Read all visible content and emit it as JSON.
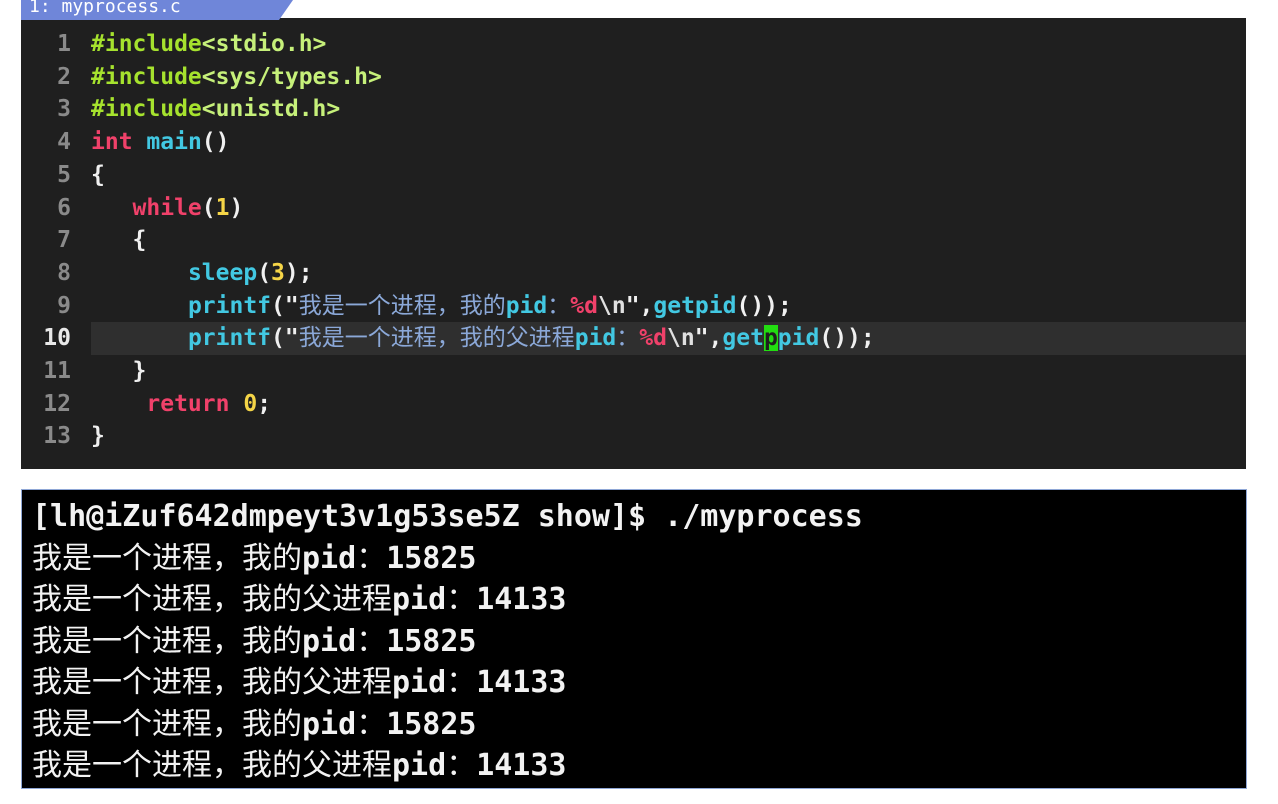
{
  "editor": {
    "tab_title": "1: myprocess.c",
    "current_line": 10,
    "lines": [
      {
        "num": "1",
        "segments": [
          {
            "t": "#include",
            "c": "pre"
          },
          {
            "t": "<stdio.h>",
            "c": "hdr"
          }
        ]
      },
      {
        "num": "2",
        "segments": [
          {
            "t": "#include",
            "c": "pre"
          },
          {
            "t": "<sys/types.h>",
            "c": "hdr"
          }
        ]
      },
      {
        "num": "3",
        "segments": [
          {
            "t": "#include",
            "c": "pre"
          },
          {
            "t": "<unistd.h>",
            "c": "hdr"
          }
        ]
      },
      {
        "num": "4",
        "segments": [
          {
            "t": "int",
            "c": "kw"
          },
          {
            "t": " ",
            "c": "plain"
          },
          {
            "t": "main",
            "c": "fn"
          },
          {
            "t": "()",
            "c": "plain"
          }
        ]
      },
      {
        "num": "5",
        "segments": [
          {
            "t": "{",
            "c": "plain"
          }
        ]
      },
      {
        "num": "6",
        "segments": [
          {
            "t": "   ",
            "c": "plain"
          },
          {
            "t": "while",
            "c": "kw"
          },
          {
            "t": "(",
            "c": "plain"
          },
          {
            "t": "1",
            "c": "num"
          },
          {
            "t": ")",
            "c": "plain"
          }
        ]
      },
      {
        "num": "7",
        "segments": [
          {
            "t": "   {",
            "c": "plain"
          }
        ]
      },
      {
        "num": "8",
        "segments": [
          {
            "t": "       ",
            "c": "plain"
          },
          {
            "t": "sleep",
            "c": "fn"
          },
          {
            "t": "(",
            "c": "plain"
          },
          {
            "t": "3",
            "c": "num"
          },
          {
            "t": ");",
            "c": "plain"
          }
        ]
      },
      {
        "num": "9",
        "segments": [
          {
            "t": "       ",
            "c": "plain"
          },
          {
            "t": "printf",
            "c": "fn"
          },
          {
            "t": "(\"",
            "c": "plain"
          },
          {
            "t": "我是一个进程，我的",
            "c": "cjk"
          },
          {
            "t": "pid",
            "c": "fn"
          },
          {
            "t": "：",
            "c": "cjk"
          },
          {
            "t": "%d",
            "c": "fmt"
          },
          {
            "t": "\\n",
            "c": "esc"
          },
          {
            "t": "\",",
            "c": "plain"
          },
          {
            "t": "getpid",
            "c": "fn"
          },
          {
            "t": "());",
            "c": "plain"
          }
        ]
      },
      {
        "num": "10",
        "segments": [
          {
            "t": "       ",
            "c": "plain"
          },
          {
            "t": "printf",
            "c": "fn"
          },
          {
            "t": "(\"",
            "c": "plain"
          },
          {
            "t": "我是一个进程，我的父进程",
            "c": "cjk"
          },
          {
            "t": "pid",
            "c": "fn"
          },
          {
            "t": "：",
            "c": "cjk"
          },
          {
            "t": "%d",
            "c": "fmt"
          },
          {
            "t": "\\n",
            "c": "esc"
          },
          {
            "t": "\",",
            "c": "plain"
          },
          {
            "t": "get",
            "c": "fn"
          },
          {
            "t": "p",
            "c": "cur"
          },
          {
            "t": "pid",
            "c": "fn"
          },
          {
            "t": "());",
            "c": "plain"
          }
        ]
      },
      {
        "num": "11",
        "segments": [
          {
            "t": "   }",
            "c": "plain"
          }
        ]
      },
      {
        "num": "12",
        "segments": [
          {
            "t": "    ",
            "c": "plain"
          },
          {
            "t": "return",
            "c": "kw"
          },
          {
            "t": " ",
            "c": "plain"
          },
          {
            "t": "0",
            "c": "num"
          },
          {
            "t": ";",
            "c": "plain"
          }
        ]
      },
      {
        "num": "13",
        "segments": [
          {
            "t": "}",
            "c": "plain"
          }
        ]
      }
    ]
  },
  "terminal": {
    "lines": [
      "[lh@iZuf642dmpeyt3v1g53se5Z show]$ ./myprocess",
      "我是一个进程，我的pid：15825",
      "我是一个进程，我的父进程pid：14133",
      "我是一个进程，我的pid：15825",
      "我是一个进程，我的父进程pid：14133",
      "我是一个进程，我的pid：15825",
      "我是一个进程，我的父进程pid：14133"
    ]
  },
  "colors": {
    "editor_bg": "#1f1f1f",
    "terminal_bg": "#000000",
    "keyword": "#f0416a",
    "function": "#42c8e2",
    "preprocessor": "#a6e22e",
    "number": "#f5d547",
    "cursor": "#22dd11"
  }
}
